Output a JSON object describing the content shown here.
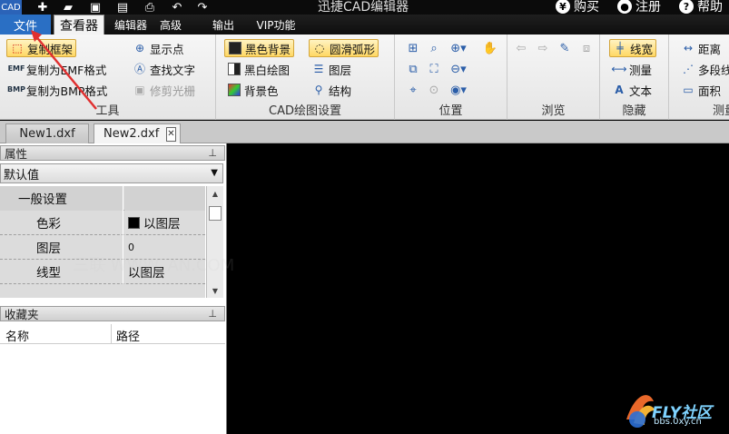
{
  "app": {
    "title": "迅捷CAD编辑器",
    "logo": "CAD",
    "buy": "购买",
    "register": "注册",
    "help": "帮助"
  },
  "menu": {
    "file": "文件",
    "viewer": "查看器",
    "editor": "编辑器",
    "advanced": "高级",
    "output": "输出",
    "vip": "VIP功能"
  },
  "ribbon": {
    "tools": {
      "label": "工具",
      "copy_frame": "复制框架",
      "copy_emf": "复制为EMF格式",
      "copy_bmp": "复制为BMP格式"
    },
    "display": {
      "show_points": "显示点",
      "find_text": "查找文字",
      "trim_raster": "修剪光栅"
    },
    "cad_draw": {
      "label": "CAD绘图设置",
      "black_bg": "黑色背景",
      "smooth_arc": "圆滑弧形",
      "bw_draw": "黑白绘图",
      "layers": "图层",
      "bg_color": "背景色",
      "structure": "结构"
    },
    "position": {
      "label": "位置"
    },
    "browse": {
      "label": "浏览"
    },
    "hide": {
      "label": "隐藏",
      "line_width": "线宽",
      "measure": "测量",
      "text": "文本"
    },
    "measure": {
      "label": "测量",
      "distance": "距离",
      "polyline": "多段线",
      "area": "面积"
    }
  },
  "tabs": [
    {
      "label": "New1.dxf",
      "active": false
    },
    {
      "label": "New2.dxf",
      "active": true
    }
  ],
  "properties": {
    "title": "属性",
    "combo_value": "默认值",
    "section": "一般设置",
    "rows": [
      {
        "key": "色彩",
        "value": "以图层"
      },
      {
        "key": "图层",
        "value": "0"
      },
      {
        "key": "线型",
        "value": "以图层"
      }
    ]
  },
  "favorites": {
    "title": "收藏夹",
    "col_name": "名称",
    "col_path": "路径"
  },
  "watermark": "三联  WWW.         AN.COM",
  "brand": {
    "name": "FLY社区",
    "url": "bbs.0xy.cn"
  },
  "colors": {
    "accent": "#2a6fc4",
    "selected": "#ffd864",
    "canvas": "#000000",
    "arrow": "#e03030"
  }
}
